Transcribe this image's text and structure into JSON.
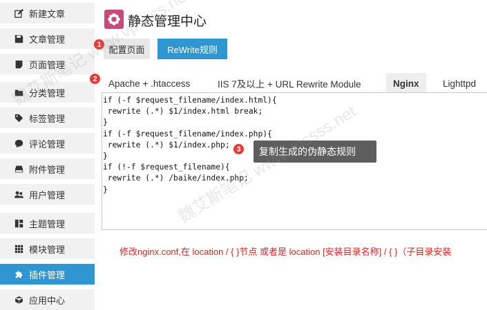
{
  "sidebar": {
    "items": [
      {
        "label": "新建文章",
        "icon": "edit-icon"
      },
      {
        "label": "文章管理",
        "icon": "save-icon"
      },
      {
        "label": "页面管理",
        "icon": "file-icon"
      },
      {
        "label": "分类管理",
        "icon": "folder-icon"
      },
      {
        "label": "标签管理",
        "icon": "tag-icon"
      },
      {
        "label": "评论管理",
        "icon": "comment-icon"
      },
      {
        "label": "附件管理",
        "icon": "hdd-icon"
      },
      {
        "label": "用户管理",
        "icon": "users-icon"
      },
      {
        "label": "主题管理",
        "icon": "layout-icon"
      },
      {
        "label": "模块管理",
        "icon": "grid-icon"
      },
      {
        "label": "插件管理",
        "icon": "puzzle-icon",
        "active": true
      },
      {
        "label": "应用中心",
        "icon": "cube-icon"
      }
    ]
  },
  "header": {
    "title": "静态管理中心"
  },
  "tabs": {
    "config": "配置页面",
    "rewrite": "ReWrite规则"
  },
  "subtabs": [
    "Apache + .htaccess",
    "IIS 7及以上 + URL Rewrite Module",
    "Nginx",
    "Lighttpd"
  ],
  "subtab_active": "Nginx",
  "code": "if (-f $request_filename/index.html){\n rewrite (.*) $1/index.html break;\n}\nif (-f $request_filename/index.php){\n rewrite (.*) $1/index.php;\n}\nif (!-f $request_filename){\n rewrite (.*) /baike/index.php;\n}",
  "hint": "修改nginx.conf,在 location / { }节点 或者是 location [安装目录名称] / { }（子目录安装",
  "tooltip": "复制生成的伪静态规则",
  "badges": [
    "1",
    "2",
    "3"
  ],
  "watermark": "魏艾斯笔记 www.vpssss.net",
  "colors": {
    "accent": "#2f96d2",
    "logo": "#c64b7b",
    "badge": "#e53935",
    "hint": "#e02020"
  }
}
